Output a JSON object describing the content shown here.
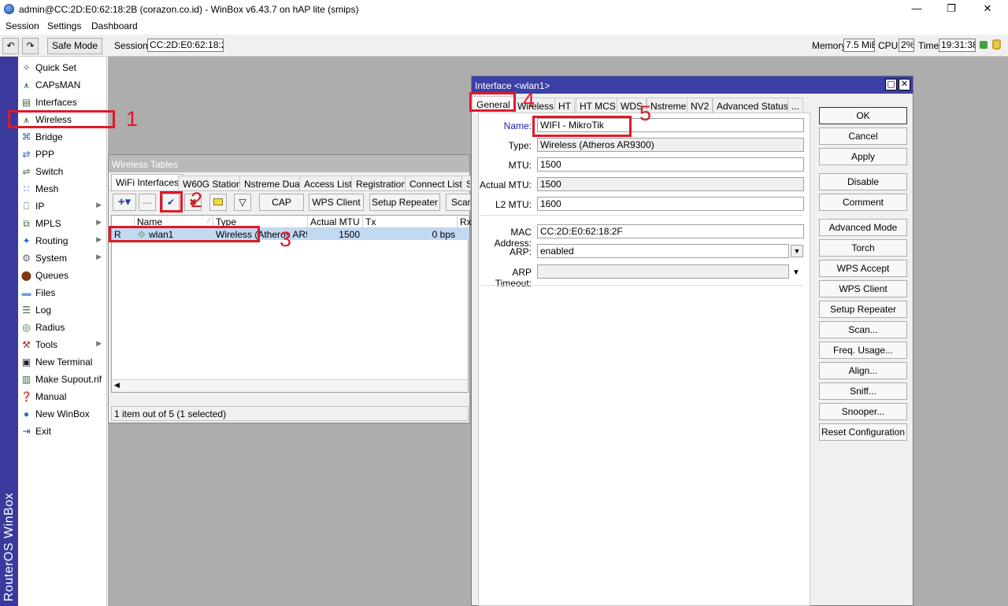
{
  "window": {
    "title": "admin@CC:2D:E0:62:18:2B (corazon.co.id) - WinBox v6.43.7 on hAP lite (smips)"
  },
  "menu": {
    "items": [
      "Session",
      "Settings",
      "Dashboard"
    ]
  },
  "toolbar": {
    "safe_mode": "Safe Mode",
    "session_label": "Session:",
    "session_value": "CC:2D:E0:62:18:2B",
    "memory_label": "Memory:",
    "memory_value": "7.5 MiB",
    "cpu_label": "CPU:",
    "cpu_value": "2%",
    "time_label": "Time:",
    "time_value": "19:31:38"
  },
  "sidebar": {
    "brand": "RouterOS WinBox",
    "items": [
      {
        "label": "Quick Set",
        "icon": "wand-icon"
      },
      {
        "label": "CAPsMAN",
        "icon": "antenna-icon"
      },
      {
        "label": "Interfaces",
        "icon": "interfaces-icon"
      },
      {
        "label": "Wireless",
        "icon": "wireless-icon"
      },
      {
        "label": "Bridge",
        "icon": "bridge-icon"
      },
      {
        "label": "PPP",
        "icon": "ppp-icon"
      },
      {
        "label": "Switch",
        "icon": "switch-icon"
      },
      {
        "label": "Mesh",
        "icon": "mesh-icon"
      },
      {
        "label": "IP",
        "icon": "ip-icon",
        "submenu": true
      },
      {
        "label": "MPLS",
        "icon": "mpls-icon",
        "submenu": true
      },
      {
        "label": "Routing",
        "icon": "routing-icon",
        "submenu": true
      },
      {
        "label": "System",
        "icon": "gear-icon",
        "submenu": true
      },
      {
        "label": "Queues",
        "icon": "queues-icon"
      },
      {
        "label": "Files",
        "icon": "folder-icon"
      },
      {
        "label": "Log",
        "icon": "log-icon"
      },
      {
        "label": "Radius",
        "icon": "radius-icon"
      },
      {
        "label": "Tools",
        "icon": "tools-icon",
        "submenu": true
      },
      {
        "label": "New Terminal",
        "icon": "terminal-icon"
      },
      {
        "label": "Make Supout.rif",
        "icon": "document-icon"
      },
      {
        "label": "Manual",
        "icon": "help-icon"
      },
      {
        "label": "New WinBox",
        "icon": "globe-icon"
      },
      {
        "label": "Exit",
        "icon": "exit-icon"
      }
    ]
  },
  "wireless_tables": {
    "title": "Wireless Tables",
    "tabs": [
      "WiFi Interfaces",
      "W60G Station",
      "Nstreme Dual",
      "Access List",
      "Registration",
      "Connect List",
      "S"
    ],
    "buttons": {
      "cap": "CAP",
      "wps_client": "WPS Client",
      "setup_repeater": "Setup Repeater",
      "scan": "Scan"
    },
    "columns": [
      "",
      "Name",
      "Type",
      "Actual MTU",
      "Tx",
      "Rx"
    ],
    "row": {
      "flag": "R",
      "name": "wlan1",
      "type": "Wireless (Atheros AR9...",
      "mtu": "1500",
      "tx": "0 bps"
    },
    "status": "1 item out of 5 (1 selected)"
  },
  "interface_window": {
    "title": "Interface <wlan1>",
    "tabs": [
      "General",
      "Wireless",
      "HT",
      "HT MCS",
      "WDS",
      "Nstreme",
      "NV2",
      "Advanced Status",
      "..."
    ],
    "fields": {
      "name_label": "Name:",
      "name_value": "WIFI - MikroTik",
      "type_label": "Type:",
      "type_value": "Wireless (Atheros AR9300)",
      "mtu_label": "MTU:",
      "mtu_value": "1500",
      "actual_mtu_label": "Actual MTU:",
      "actual_mtu_value": "1500",
      "l2mtu_label": "L2 MTU:",
      "l2mtu_value": "1600",
      "mac_label": "MAC Address:",
      "mac_value": "CC:2D:E0:62:18:2F",
      "arp_label": "ARP:",
      "arp_value": "enabled",
      "arp_timeout_label": "ARP Timeout:",
      "arp_timeout_value": ""
    },
    "buttons": [
      "OK",
      "Cancel",
      "Apply",
      "Disable",
      "Comment",
      "Advanced Mode",
      "Torch",
      "WPS Accept",
      "WPS Client",
      "Setup Repeater",
      "Scan...",
      "Freq. Usage...",
      "Align...",
      "Sniff...",
      "Snooper...",
      "Reset Configuration"
    ]
  },
  "annotations": [
    "1",
    "2",
    "3",
    "4",
    "5"
  ],
  "colors": {
    "accent_red": "#e0192b",
    "title_active": "#3b40a6",
    "sidebar_strip": "#3a3a9e"
  }
}
